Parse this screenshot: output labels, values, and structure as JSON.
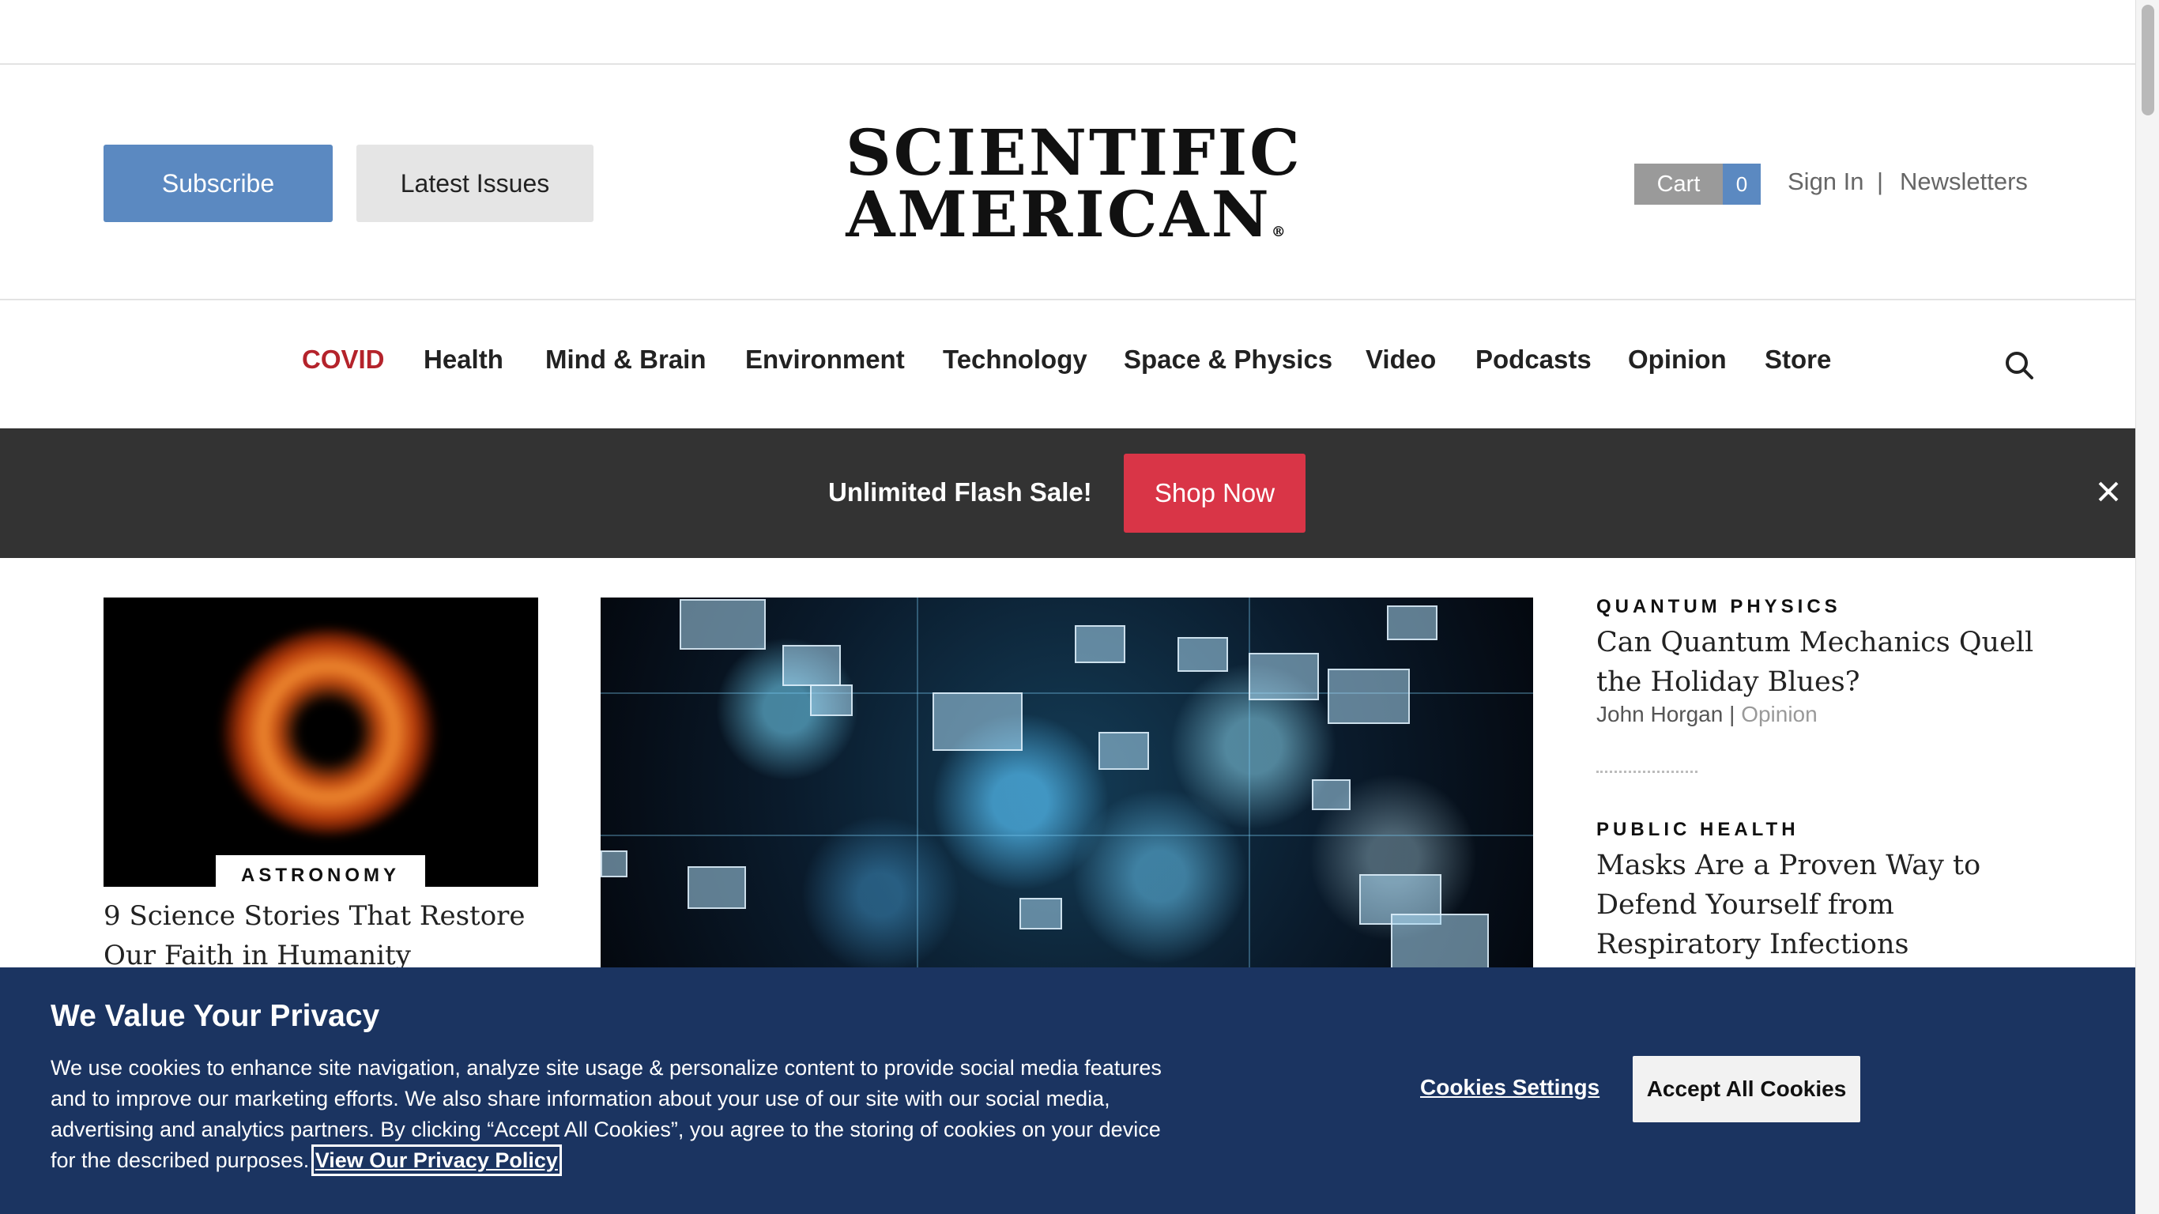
{
  "header": {
    "subscribe_label": "Subscribe",
    "latest_issues_label": "Latest Issues",
    "logo_line1": "SCIENTIFIC",
    "logo_line2": "AMERICAN",
    "logo_registered": "®",
    "cart_label": "Cart",
    "cart_count": "0",
    "sign_in": "Sign In",
    "separator": "|",
    "newsletters": "Newsletters"
  },
  "nav": {
    "items": [
      "COVID",
      "Health",
      "Mind & Brain",
      "Environment",
      "Technology",
      "Space & Physics",
      "Video",
      "Podcasts",
      "Opinion",
      "Store"
    ],
    "search_icon": "search-icon"
  },
  "promo": {
    "text": "Unlimited Flash Sale!",
    "button": "Shop Now",
    "close_icon": "close-icon"
  },
  "cards": {
    "left": {
      "category": "ASTRONOMY",
      "title": "9 Science Stories That Restore Our Faith in Humanity"
    }
  },
  "side_articles": [
    {
      "category": "QUANTUM PHYSICS",
      "title": "Can Quantum Mechanics Quell the Holiday Blues?",
      "author": "John Horgan",
      "meta_sep": "|",
      "type": "Opinion"
    },
    {
      "category": "PUBLIC HEALTH",
      "title": "Masks Are a Proven Way to Defend Yourself from Respiratory Infections"
    }
  ],
  "privacy": {
    "title": "We Value Your Privacy",
    "body": "We use cookies to enhance site navigation, analyze site usage & personalize content to provide social media features and to improve our marketing efforts. We also share information about your use of our site with our social media, advertising and analytics partners. By clicking “Accept All Cookies”, you agree to the storing of cookies on your device for the described purposes.",
    "policy_link": "View Our Privacy Policy",
    "cookies_settings": "Cookies Settings",
    "accept_all": "Accept All Cookies"
  },
  "colors": {
    "subscribe_blue": "#5b89c1",
    "covid_red": "#b4232b",
    "promo_bg": "#333333",
    "shop_red": "#d93547",
    "privacy_bg": "#1b3461"
  }
}
